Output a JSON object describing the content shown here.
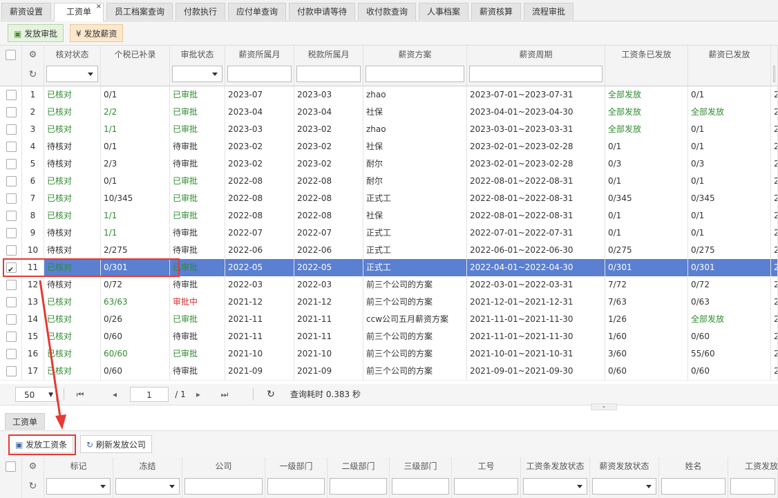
{
  "tabs": [
    {
      "label": "薪资设置"
    },
    {
      "label": "工资单",
      "active": true
    },
    {
      "label": "员工档案查询"
    },
    {
      "label": "付款执行"
    },
    {
      "label": "应付单查询"
    },
    {
      "label": "付款申请等待"
    },
    {
      "label": "收付款查询"
    },
    {
      "label": "人事档案"
    },
    {
      "label": "薪资核算"
    },
    {
      "label": "流程审批"
    }
  ],
  "tab_close": "×",
  "toolbar": {
    "approve_label": "发放审批",
    "pay_label": "发放薪资",
    "pay_icon": "¥"
  },
  "columns": [
    "核对状态",
    "个税已补录",
    "审批状态",
    "薪资所属月",
    "税款所属月",
    "薪资方案",
    "薪资周期",
    "工资条已发放",
    "薪资已发放",
    "2"
  ],
  "rows": [
    {
      "no": "1",
      "check": "已核对",
      "tax": "0/1",
      "approval": "已审批",
      "salary_month": "2023-07",
      "tax_month": "2023-03",
      "plan": "zhao",
      "period": "2023-07-01~2023-07-31",
      "slip": "全部发放",
      "paid": "0/1",
      "extra": "2"
    },
    {
      "no": "2",
      "check": "已核对",
      "tax": "2/2",
      "approval": "已审批",
      "salary_month": "2023-04",
      "tax_month": "2023-04",
      "plan": "社保",
      "period": "2023-04-01~2023-04-30",
      "slip": "全部发放",
      "paid": "全部发放",
      "extra": "2"
    },
    {
      "no": "3",
      "check": "已核对",
      "tax": "1/1",
      "approval": "已审批",
      "salary_month": "2023-03",
      "tax_month": "2023-02",
      "plan": "zhao",
      "period": "2023-03-01~2023-03-31",
      "slip": "全部发放",
      "paid": "0/1",
      "extra": "2"
    },
    {
      "no": "4",
      "check": "待核对",
      "tax": "0/1",
      "approval": "待审批",
      "salary_month": "2023-02",
      "tax_month": "2023-02",
      "plan": "社保",
      "period": "2023-02-01~2023-02-28",
      "slip": "0/1",
      "paid": "0/1",
      "extra": "2"
    },
    {
      "no": "5",
      "check": "待核对",
      "tax": "2/3",
      "approval": "待审批",
      "salary_month": "2023-02",
      "tax_month": "2023-02",
      "plan": "耐尔",
      "period": "2023-02-01~2023-02-28",
      "slip": "0/3",
      "paid": "0/3",
      "extra": "2"
    },
    {
      "no": "6",
      "check": "已核对",
      "tax": "0/1",
      "approval": "已审批",
      "salary_month": "2022-08",
      "tax_month": "2022-08",
      "plan": "耐尔",
      "period": "2022-08-01~2022-08-31",
      "slip": "0/1",
      "paid": "0/1",
      "extra": "2"
    },
    {
      "no": "7",
      "check": "已核对",
      "tax": "10/345",
      "approval": "已审批",
      "salary_month": "2022-08",
      "tax_month": "2022-08",
      "plan": "正式工",
      "period": "2022-08-01~2022-08-31",
      "slip": "0/345",
      "paid": "0/345",
      "extra": "2"
    },
    {
      "no": "8",
      "check": "已核对",
      "tax": "1/1",
      "approval": "已审批",
      "salary_month": "2022-08",
      "tax_month": "2022-08",
      "plan": "社保",
      "period": "2022-08-01~2022-08-31",
      "slip": "0/1",
      "paid": "0/1",
      "extra": "2"
    },
    {
      "no": "9",
      "check": "待核对",
      "tax": "1/1",
      "approval": "待审批",
      "salary_month": "2022-07",
      "tax_month": "2022-07",
      "plan": "正式工",
      "period": "2022-07-01~2022-07-31",
      "slip": "0/1",
      "paid": "0/1",
      "extra": "2"
    },
    {
      "no": "10",
      "check": "待核对",
      "tax": "2/275",
      "approval": "待审批",
      "salary_month": "2022-06",
      "tax_month": "2022-06",
      "plan": "正式工",
      "period": "2022-06-01~2022-06-30",
      "slip": "0/275",
      "paid": "0/275",
      "extra": "2"
    },
    {
      "no": "11",
      "check": "已核对",
      "tax": "0/301",
      "approval": "已审批",
      "salary_month": "2022-05",
      "tax_month": "2022-05",
      "plan": "正式工",
      "period": "2022-04-01~2022-04-30",
      "slip": "0/301",
      "paid": "0/301",
      "extra": "2",
      "selected": true
    },
    {
      "no": "12",
      "check": "待核对",
      "tax": "0/72",
      "approval": "待审批",
      "salary_month": "2022-03",
      "tax_month": "2022-03",
      "plan": "前三个公司的方案",
      "period": "2022-03-01~2022-03-31",
      "slip": "7/72",
      "paid": "0/72",
      "extra": "2"
    },
    {
      "no": "13",
      "check": "已核对",
      "tax": "63/63",
      "approval": "审批中",
      "salary_month": "2021-12",
      "tax_month": "2021-12",
      "plan": "前三个公司的方案",
      "period": "2021-12-01~2021-12-31",
      "slip": "7/63",
      "paid": "0/63",
      "extra": "2"
    },
    {
      "no": "14",
      "check": "已核对",
      "tax": "0/26",
      "approval": "已审批",
      "salary_month": "2021-11",
      "tax_month": "2021-11",
      "plan": "ccw公司五月薪资方案",
      "period": "2021-11-01~2021-11-30",
      "slip": "1/26",
      "paid": "全部发放",
      "extra": "2"
    },
    {
      "no": "15",
      "check": "已核对",
      "tax": "0/60",
      "approval": "待审批",
      "salary_month": "2021-11",
      "tax_month": "2021-11",
      "plan": "前三个公司的方案",
      "period": "2021-11-01~2021-11-30",
      "slip": "1/60",
      "paid": "0/60",
      "extra": "2"
    },
    {
      "no": "16",
      "check": "已核对",
      "tax": "60/60",
      "approval": "已审批",
      "salary_month": "2021-10",
      "tax_month": "2021-10",
      "plan": "前三个公司的方案",
      "period": "2021-10-01~2021-10-31",
      "slip": "3/60",
      "paid": "55/60",
      "extra": "2"
    },
    {
      "no": "17",
      "check": "已核对",
      "tax": "0/60",
      "approval": "待审批",
      "salary_month": "2021-09",
      "tax_month": "2021-09",
      "plan": "前三个公司的方案",
      "period": "2021-09-01~2021-09-30",
      "slip": "0/60",
      "paid": "0/60",
      "extra": "2"
    }
  ],
  "pager": {
    "page_size": "50",
    "page": "1",
    "total_pages": "/ 1",
    "query_time": "查询耗时 0.383 秒"
  },
  "bottom": {
    "tab_label": "工资单",
    "issue_slip_label": "发放工资条",
    "refresh_company_label": "刷新发放公司",
    "columns": [
      "标记",
      "冻结",
      "公司",
      "一级部门",
      "二级部门",
      "三级部门",
      "工号",
      "工资条发放状态",
      "薪资发放状态",
      "姓名",
      "工资发放"
    ]
  },
  "colors": {
    "selected_row": "#5b7fd1",
    "status_green": "#2e8b2e",
    "status_red": "#d32f2f",
    "annotation_red": "#e53935"
  },
  "icons": [
    "gear-icon",
    "refresh-icon",
    "approve-icon",
    "yen-icon",
    "first-page-icon",
    "prev-page-icon",
    "next-page-icon",
    "last-page-icon",
    "reload-icon",
    "save-icon",
    "arrow-annotation"
  ]
}
